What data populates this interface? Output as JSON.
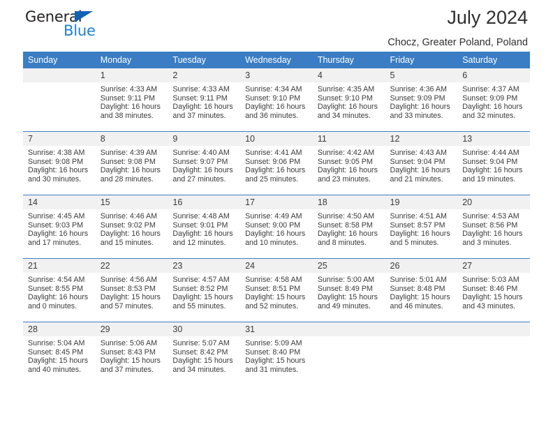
{
  "brand": {
    "name_dark": "General",
    "name_blue": "Blue",
    "color_dark": "#231f20",
    "color_blue": "#1f7fd4",
    "triangle_color": "#1262b3"
  },
  "header": {
    "title": "July 2024",
    "subtitle": "Chocz, Greater Poland, Poland",
    "header_bg": "#3a7dc4",
    "header_text_color": "#ffffff"
  },
  "weekdays": [
    "Sunday",
    "Monday",
    "Tuesday",
    "Wednesday",
    "Thursday",
    "Friday",
    "Saturday"
  ],
  "weeks": [
    [
      {
        "day": ""
      },
      {
        "day": "1",
        "sunrise": "Sunrise: 4:33 AM",
        "sunset": "Sunset: 9:11 PM",
        "daylight": "Daylight: 16 hours and 38 minutes."
      },
      {
        "day": "2",
        "sunrise": "Sunrise: 4:33 AM",
        "sunset": "Sunset: 9:11 PM",
        "daylight": "Daylight: 16 hours and 37 minutes."
      },
      {
        "day": "3",
        "sunrise": "Sunrise: 4:34 AM",
        "sunset": "Sunset: 9:10 PM",
        "daylight": "Daylight: 16 hours and 36 minutes."
      },
      {
        "day": "4",
        "sunrise": "Sunrise: 4:35 AM",
        "sunset": "Sunset: 9:10 PM",
        "daylight": "Daylight: 16 hours and 34 minutes."
      },
      {
        "day": "5",
        "sunrise": "Sunrise: 4:36 AM",
        "sunset": "Sunset: 9:09 PM",
        "daylight": "Daylight: 16 hours and 33 minutes."
      },
      {
        "day": "6",
        "sunrise": "Sunrise: 4:37 AM",
        "sunset": "Sunset: 9:09 PM",
        "daylight": "Daylight: 16 hours and 32 minutes."
      }
    ],
    [
      {
        "day": "7",
        "sunrise": "Sunrise: 4:38 AM",
        "sunset": "Sunset: 9:08 PM",
        "daylight": "Daylight: 16 hours and 30 minutes."
      },
      {
        "day": "8",
        "sunrise": "Sunrise: 4:39 AM",
        "sunset": "Sunset: 9:08 PM",
        "daylight": "Daylight: 16 hours and 28 minutes."
      },
      {
        "day": "9",
        "sunrise": "Sunrise: 4:40 AM",
        "sunset": "Sunset: 9:07 PM",
        "daylight": "Daylight: 16 hours and 27 minutes."
      },
      {
        "day": "10",
        "sunrise": "Sunrise: 4:41 AM",
        "sunset": "Sunset: 9:06 PM",
        "daylight": "Daylight: 16 hours and 25 minutes."
      },
      {
        "day": "11",
        "sunrise": "Sunrise: 4:42 AM",
        "sunset": "Sunset: 9:05 PM",
        "daylight": "Daylight: 16 hours and 23 minutes."
      },
      {
        "day": "12",
        "sunrise": "Sunrise: 4:43 AM",
        "sunset": "Sunset: 9:04 PM",
        "daylight": "Daylight: 16 hours and 21 minutes."
      },
      {
        "day": "13",
        "sunrise": "Sunrise: 4:44 AM",
        "sunset": "Sunset: 9:04 PM",
        "daylight": "Daylight: 16 hours and 19 minutes."
      }
    ],
    [
      {
        "day": "14",
        "sunrise": "Sunrise: 4:45 AM",
        "sunset": "Sunset: 9:03 PM",
        "daylight": "Daylight: 16 hours and 17 minutes."
      },
      {
        "day": "15",
        "sunrise": "Sunrise: 4:46 AM",
        "sunset": "Sunset: 9:02 PM",
        "daylight": "Daylight: 16 hours and 15 minutes."
      },
      {
        "day": "16",
        "sunrise": "Sunrise: 4:48 AM",
        "sunset": "Sunset: 9:01 PM",
        "daylight": "Daylight: 16 hours and 12 minutes."
      },
      {
        "day": "17",
        "sunrise": "Sunrise: 4:49 AM",
        "sunset": "Sunset: 9:00 PM",
        "daylight": "Daylight: 16 hours and 10 minutes."
      },
      {
        "day": "18",
        "sunrise": "Sunrise: 4:50 AM",
        "sunset": "Sunset: 8:58 PM",
        "daylight": "Daylight: 16 hours and 8 minutes."
      },
      {
        "day": "19",
        "sunrise": "Sunrise: 4:51 AM",
        "sunset": "Sunset: 8:57 PM",
        "daylight": "Daylight: 16 hours and 5 minutes."
      },
      {
        "day": "20",
        "sunrise": "Sunrise: 4:53 AM",
        "sunset": "Sunset: 8:56 PM",
        "daylight": "Daylight: 16 hours and 3 minutes."
      }
    ],
    [
      {
        "day": "21",
        "sunrise": "Sunrise: 4:54 AM",
        "sunset": "Sunset: 8:55 PM",
        "daylight": "Daylight: 16 hours and 0 minutes."
      },
      {
        "day": "22",
        "sunrise": "Sunrise: 4:56 AM",
        "sunset": "Sunset: 8:53 PM",
        "daylight": "Daylight: 15 hours and 57 minutes."
      },
      {
        "day": "23",
        "sunrise": "Sunrise: 4:57 AM",
        "sunset": "Sunset: 8:52 PM",
        "daylight": "Daylight: 15 hours and 55 minutes."
      },
      {
        "day": "24",
        "sunrise": "Sunrise: 4:58 AM",
        "sunset": "Sunset: 8:51 PM",
        "daylight": "Daylight: 15 hours and 52 minutes."
      },
      {
        "day": "25",
        "sunrise": "Sunrise: 5:00 AM",
        "sunset": "Sunset: 8:49 PM",
        "daylight": "Daylight: 15 hours and 49 minutes."
      },
      {
        "day": "26",
        "sunrise": "Sunrise: 5:01 AM",
        "sunset": "Sunset: 8:48 PM",
        "daylight": "Daylight: 15 hours and 46 minutes."
      },
      {
        "day": "27",
        "sunrise": "Sunrise: 5:03 AM",
        "sunset": "Sunset: 8:46 PM",
        "daylight": "Daylight: 15 hours and 43 minutes."
      }
    ],
    [
      {
        "day": "28",
        "sunrise": "Sunrise: 5:04 AM",
        "sunset": "Sunset: 8:45 PM",
        "daylight": "Daylight: 15 hours and 40 minutes."
      },
      {
        "day": "29",
        "sunrise": "Sunrise: 5:06 AM",
        "sunset": "Sunset: 8:43 PM",
        "daylight": "Daylight: 15 hours and 37 minutes."
      },
      {
        "day": "30",
        "sunrise": "Sunrise: 5:07 AM",
        "sunset": "Sunset: 8:42 PM",
        "daylight": "Daylight: 15 hours and 34 minutes."
      },
      {
        "day": "31",
        "sunrise": "Sunrise: 5:09 AM",
        "sunset": "Sunset: 8:40 PM",
        "daylight": "Daylight: 15 hours and 31 minutes."
      },
      {
        "day": ""
      },
      {
        "day": ""
      },
      {
        "day": ""
      }
    ]
  ]
}
